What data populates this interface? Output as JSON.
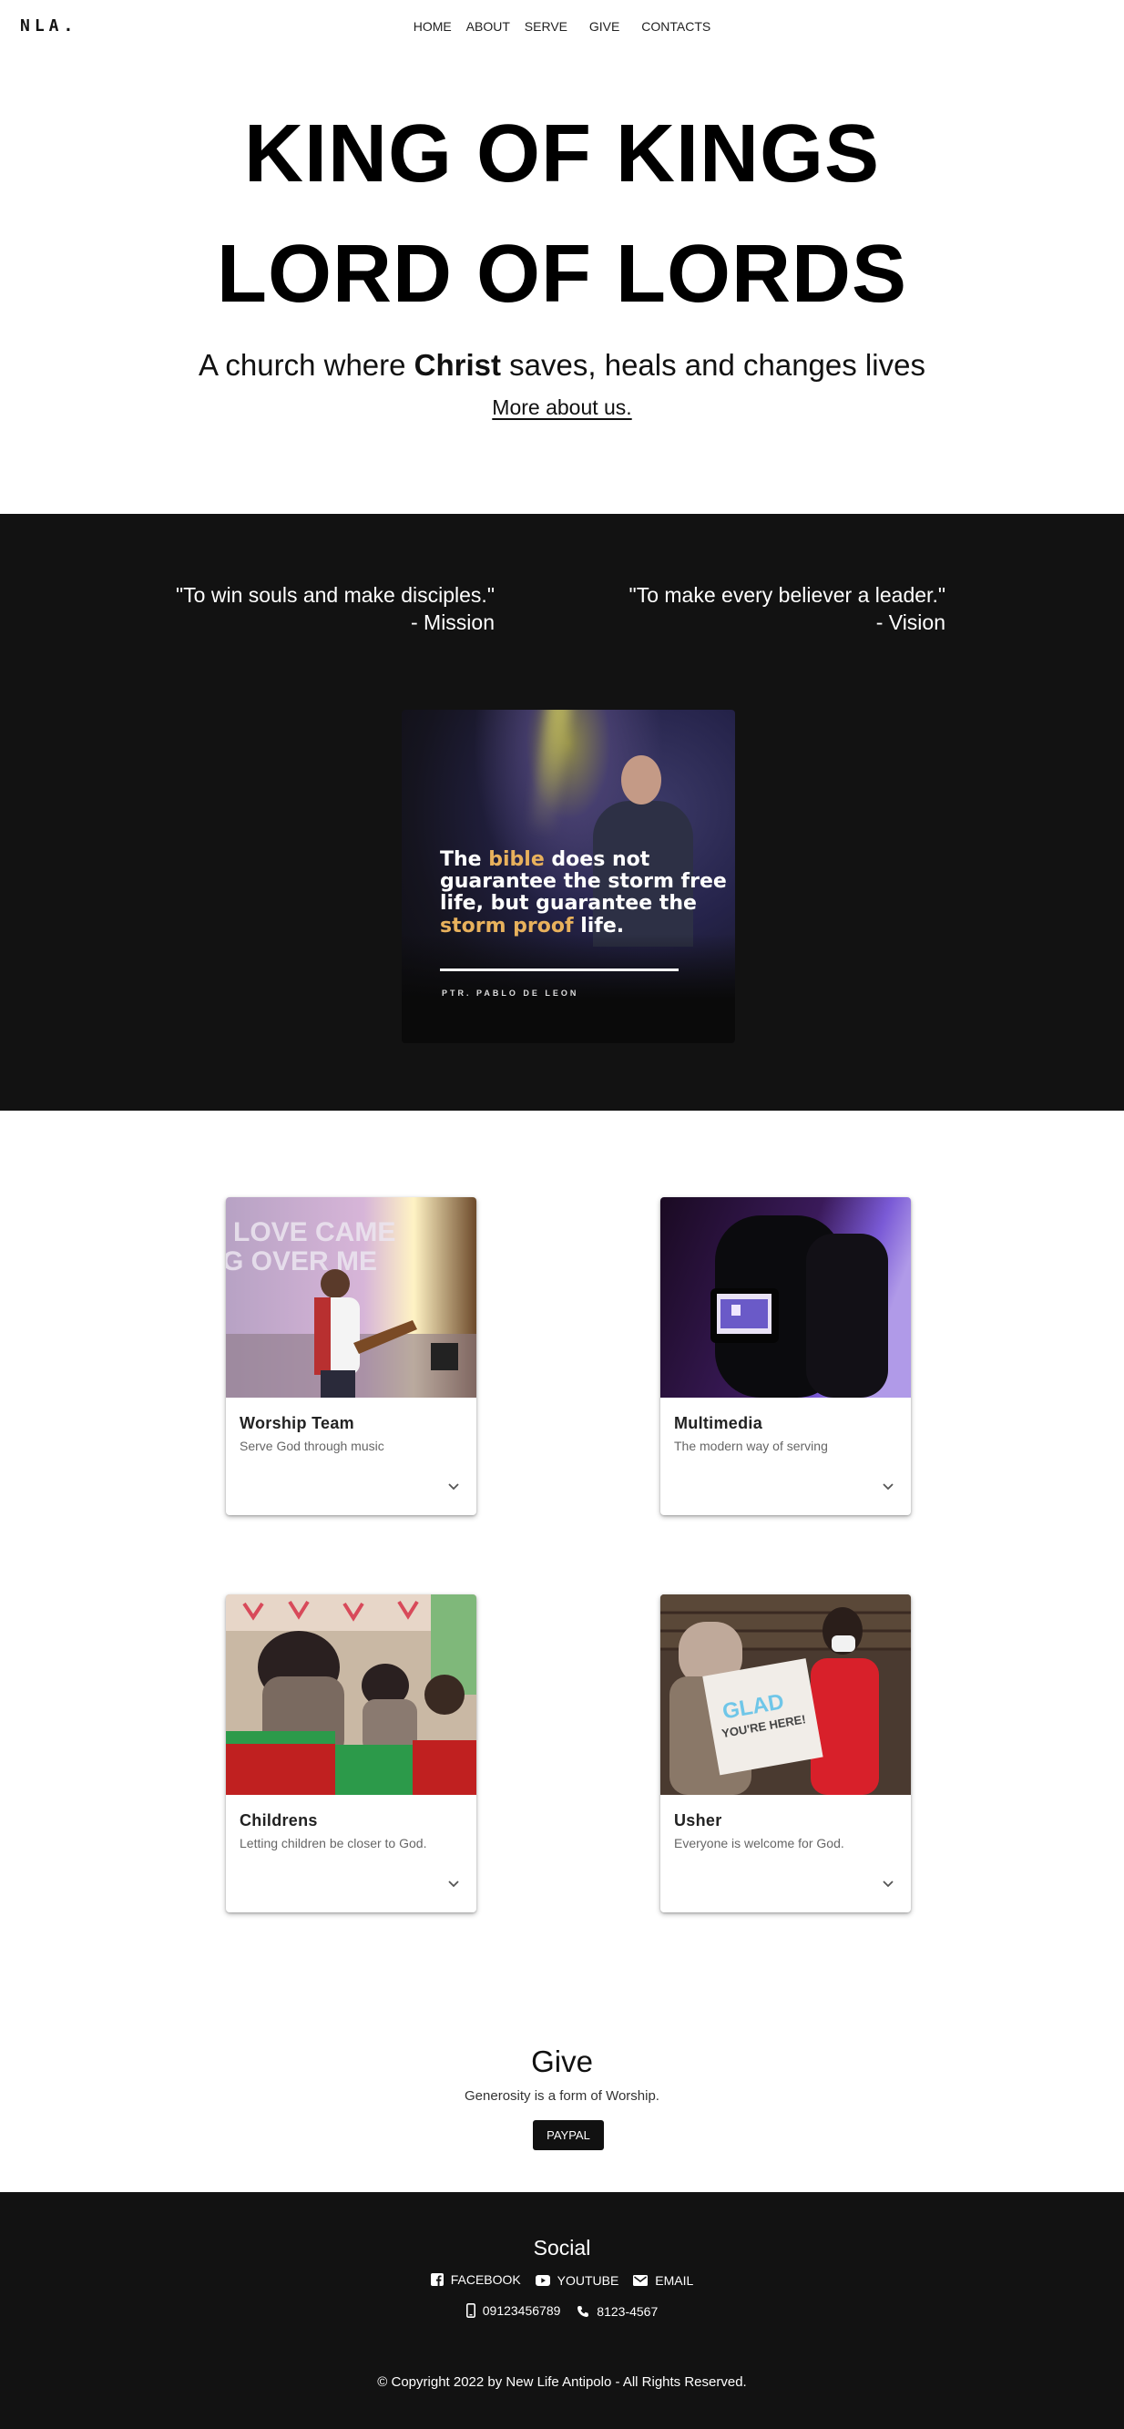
{
  "nav": {
    "logo": "NLA.",
    "links": [
      "HOME",
      "ABOUT",
      "SERVE",
      "GIVE",
      "CONTACTS"
    ]
  },
  "hero": {
    "line1": "KING OF KINGS",
    "line2": "LORD OF LORDS",
    "tagline_before": "A church where ",
    "tagline_bold": "Christ",
    "tagline_after": " saves, heals and changes lives",
    "more_link": "More about us."
  },
  "statements": {
    "mission_quote": "\"To win souls and make disciples.\"",
    "mission_label": "- Mission",
    "vision_quote": "\"To make every believer a leader.\"",
    "vision_label": "- Vision"
  },
  "poster": {
    "text_1": "The ",
    "text_hl1": "bible",
    "text_2": " does not guarantee the storm free life, but guarantee the ",
    "text_hl2": "storm proof",
    "text_3": " life.",
    "author": "PTR. PABLO DE LEON",
    "highlight_color": "#e8b15c"
  },
  "serve": {
    "cards": [
      {
        "title": "Worship Team",
        "subtitle": "Serve God through music"
      },
      {
        "title": "Multimedia",
        "subtitle": "The modern way of serving"
      },
      {
        "title": "Childrens",
        "subtitle": "Letting children be closer to God."
      },
      {
        "title": "Usher",
        "subtitle": "Everyone is welcome for God."
      }
    ],
    "worship_image_text": "LOVE CAME\nG OVER ME",
    "usher_sign_line1": "GLAD",
    "usher_sign_line2": "YOU'RE HERE!"
  },
  "give": {
    "title": "Give",
    "subtitle": "Generosity is a form of Worship.",
    "button": "PAYPAL"
  },
  "footer": {
    "social_title": "Social",
    "facebook": "FACEBOOK",
    "youtube": "YOUTUBE",
    "email": "EMAIL",
    "mobile": "09123456789",
    "phone": "8123-4567",
    "copyright": "© Copyright 2022 by New Life Antipolo - All Rights Reserved."
  },
  "colors": {
    "dark_background": "#121212",
    "accent_gold": "#e8b15c"
  }
}
